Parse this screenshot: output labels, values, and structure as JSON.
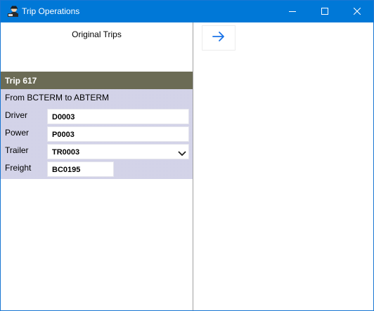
{
  "window": {
    "title": "Trip Operations",
    "titlebar_color": "#0078d7",
    "controls": [
      "minimize-icon",
      "maximize-icon",
      "close-icon"
    ]
  },
  "left_pane": {
    "section_title": "Original Trips",
    "trip": {
      "header": "Trip 617",
      "route": "From BCTERM to ABTERM",
      "fields": {
        "driver": {
          "label": "Driver",
          "value": "D0003"
        },
        "power": {
          "label": "Power",
          "value": "P0003"
        },
        "trailer": {
          "label": "Trailer",
          "value": "TR0003"
        },
        "freight": {
          "label": "Freight",
          "value": "BC0195"
        }
      },
      "header_color": "#6b6b55",
      "body_color": "#dcdcee"
    }
  },
  "right_pane": {
    "arrow_icon": "arrow-right-icon",
    "accent_color": "#1a73e8"
  }
}
